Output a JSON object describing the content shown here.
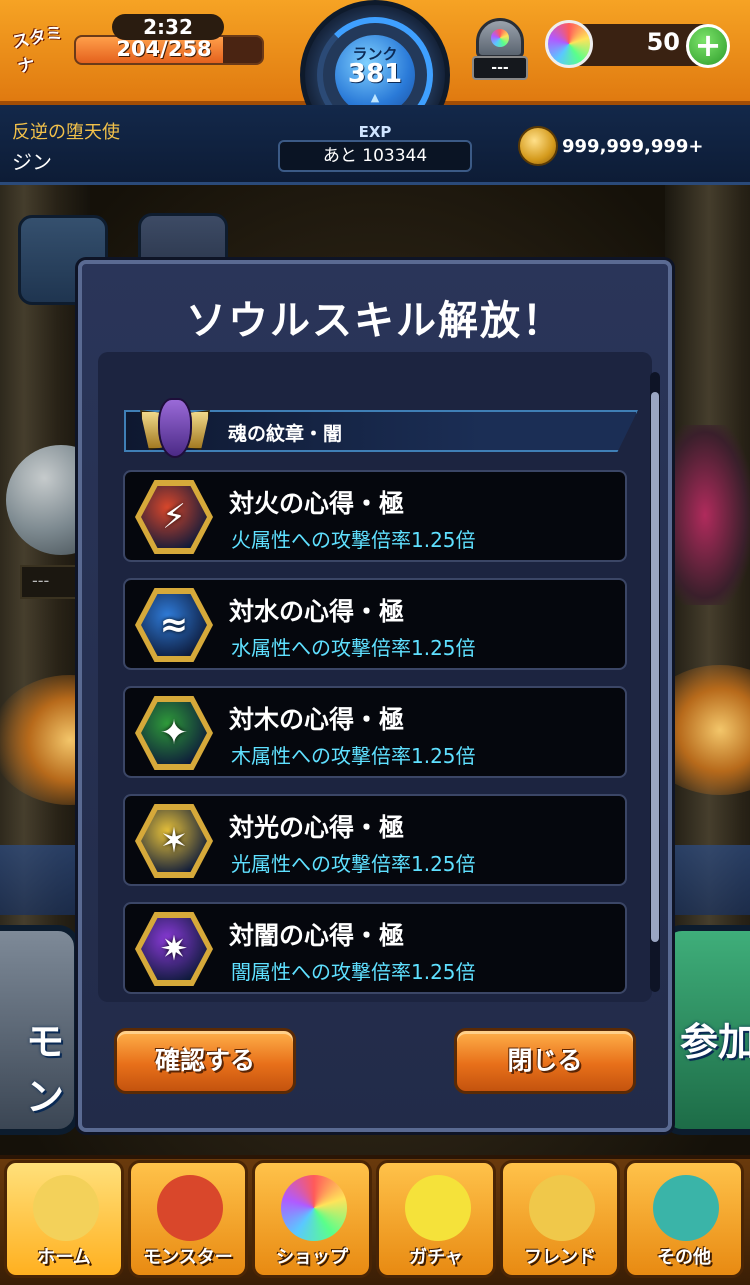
{
  "hud": {
    "stamina_icon_label": "スタミナ",
    "stamina_timer": "2:32",
    "stamina_value": "204/258",
    "stamina_fraction": 0.79,
    "rank_label": "ランク",
    "rank_value": "381",
    "stone_tag": "---",
    "orb_count": "50",
    "plus_label": "+",
    "player_title": "反逆の堕天使",
    "player_name": "ジン",
    "exp_label": "EXP",
    "exp_remaining": "あと 103344",
    "coin_value": "999,999,999+"
  },
  "background": {
    "pedestal_label": "---",
    "left_card_text": "モン",
    "right_card_text": "参加"
  },
  "modal": {
    "title": "ソウルスキル解放！",
    "category_label": "魂の紋章・闇",
    "skills": [
      {
        "name": "対火の心得・極",
        "desc": "火属性への攻撃倍率1.25倍",
        "element_color": "#d9472b",
        "icon": "fire-element-icon"
      },
      {
        "name": "対水の心得・極",
        "desc": "水属性への攻撃倍率1.25倍",
        "element_color": "#2f7bd8",
        "icon": "water-element-icon"
      },
      {
        "name": "対木の心得・極",
        "desc": "木属性への攻撃倍率1.25倍",
        "element_color": "#2f9b3a",
        "icon": "wood-element-icon"
      },
      {
        "name": "対光の心得・極",
        "desc": "光属性への攻撃倍率1.25倍",
        "element_color": "#e8c23a",
        "icon": "light-element-icon"
      },
      {
        "name": "対闇の心得・極",
        "desc": "闇属性への攻撃倍率1.25倍",
        "element_color": "#8a3ad8",
        "icon": "dark-element-icon"
      }
    ],
    "confirm_label": "確認する",
    "close_label": "閉じる"
  },
  "nav": [
    {
      "label": "ホーム",
      "icon": "home-gate-icon"
    },
    {
      "label": "モンスター",
      "icon": "monster-icon"
    },
    {
      "label": "ショップ",
      "icon": "rainbow-orb-icon"
    },
    {
      "label": "ガチャ",
      "icon": "egg-icon"
    },
    {
      "label": "フレンド",
      "icon": "friends-icon"
    },
    {
      "label": "その他",
      "icon": "misc-icon"
    }
  ],
  "colors": {
    "hud_orange": "#f6a324",
    "skill_desc_cyan": "#5fe0ff",
    "button_orange": "#e8701a",
    "title_gold": "#f2c14a"
  }
}
